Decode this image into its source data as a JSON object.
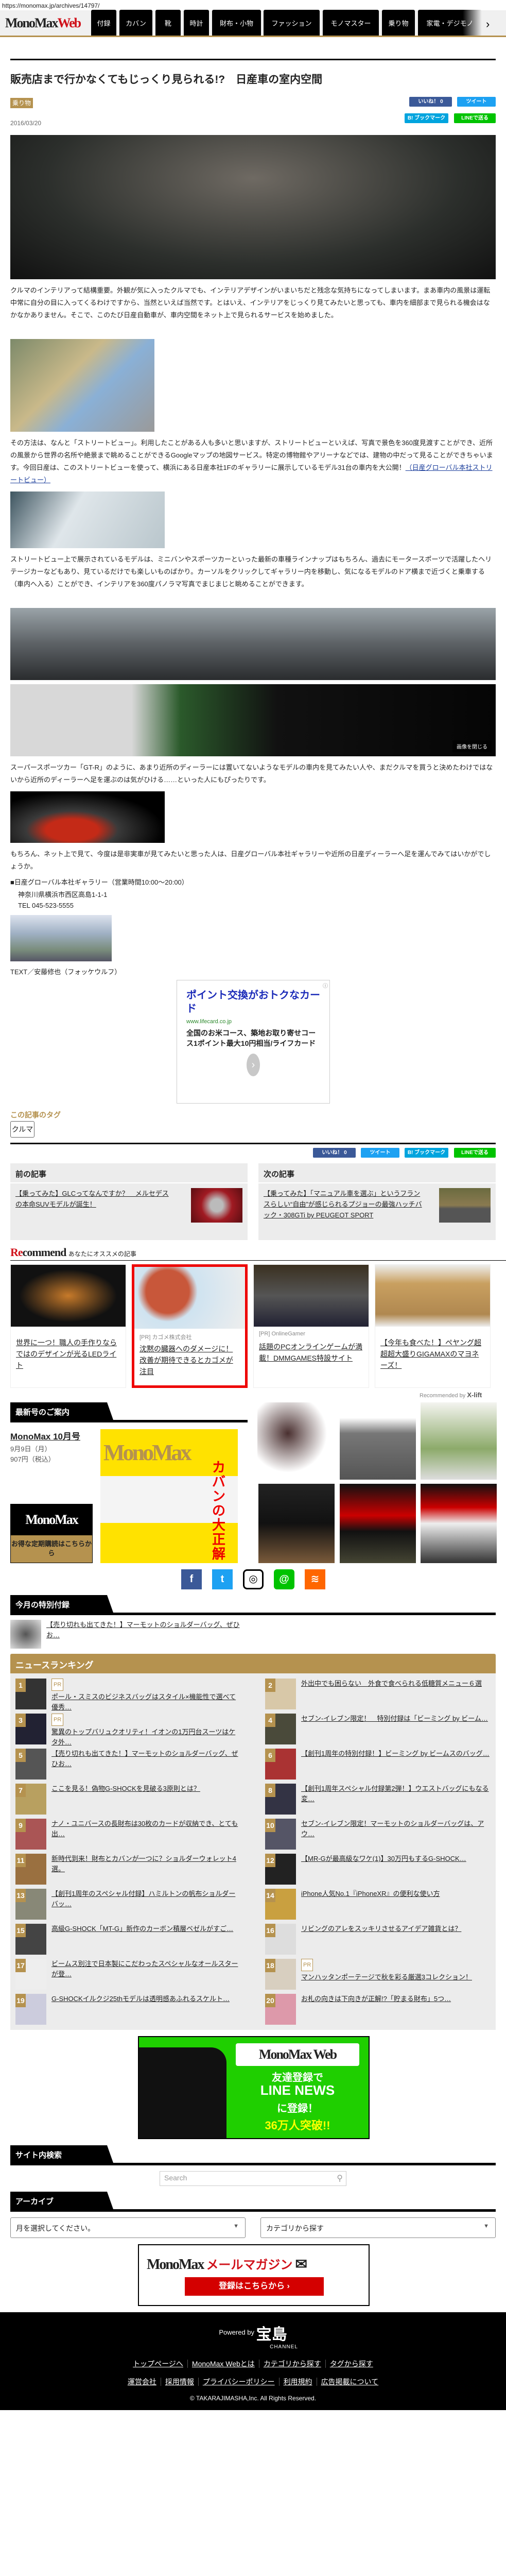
{
  "url": "https://monomax.jp/archives/14797/",
  "header": {
    "logo_mono": "MonoMax",
    "logo_web": "Web",
    "nav": [
      "付録",
      "カバン",
      "靴",
      "時計",
      "財布・小物",
      "ファッション",
      "モノマスター",
      "乗り物",
      "家電・デジモノ"
    ],
    "next": "›"
  },
  "article": {
    "title": "販売店まで行かなくてもじっくり見られる!?　日産車の室内空間",
    "category": "乗り物",
    "date": "2016/03/20",
    "share": {
      "like": "いいね！ 0",
      "tweet": "ツイート",
      "bookmark": "B! ブックマーク",
      "line": "LINEで送る"
    },
    "p1": "クルマのインテリアって結構重要。外観が気に入ったクルマでも、インテリアデザインがいまいちだと残念な気持ちになってしまいます。まあ車内の風景は運転中常に自分の目に入ってくるわけですから、当然といえば当然です。とはいえ、インテリアをじっくり見てみたいと思っても、車内を細部まで見られる機会はなかなかありません。そこで、このたび日産自動車が、車内空間をネット上で見られるサービスを始めました。",
    "p2": "その方法は、なんと「ストリートビュー」。利用したことがある人も多いと思いますが、ストリートビューといえば、写真で景色を360度見渡すことができ、近所の風景から世界の名所や絶景まで眺めることができるGoogleマップの地図サービス。特定の博物館やアリーナなどでは、建物の中だって見ることができちゃいます。今回日産は、このストリートビューを使って、横浜にある日産本社1Fのギャラリーに展示しているモデル31台の車内を大公開！",
    "p2_link": "（日産グローバル本社ストリートビュー）",
    "p3": "ストリートビュー上で展示されているモデルは、ミニバンやスポーツカーといった最新の車種ラインナップはもちろん、過去にモータースポーツで活躍したヘリテージカーなどもあり、見ているだけでも楽しいものばかり。カーソルをクリックしてギャラリー内を移動し、気になるモデルのドア横まで近づくと乗車する（車内へ入る）ことができ、インテリアを360度パノラマ写真でまじまじと眺めることができます。",
    "sv_control": "画像を閉じる",
    "p4": "スーパースポーツカー「GT-R」のように、あまり近所のディーラーには置いてないようなモデルの車内を見てみたい人や、まだクルマを買うと決めたわけではないから近所のディーラーへ足を運ぶのは気がひける……といった人にもぴったりです。",
    "p5": "もちろん、ネット上で見て、今度は是非実車が見てみたいと思った人は、日産グローバル本社ギャラリーや近所の日産ディーラーへ足を運んでみてはいかがでしょうか。",
    "gallery": "■日産グローバル本社ギャラリー（営業時間10:00～20:00）",
    "address": "神奈川県横浜市西区高島1-1-1",
    "tel": "TEL 045-523-5555",
    "credit": "TEXT／安藤修也（フォッケウルフ）"
  },
  "ad": {
    "info": "ⓘ",
    "headline": "ポイント交換がおトクなカード",
    "domain": "www.lifecard.co.jp",
    "desc": "全国のお米コース、築地お取り寄せコース1ポイント最大10円相当/ライフカード",
    "arrow": "›"
  },
  "tags": {
    "heading": "この記事のタグ",
    "items": [
      "クルマ"
    ]
  },
  "prevnext": {
    "prev_label": "前の記事",
    "prev_title": "【乗ってみた】GLCってなんですか？　メルセデスの本命SUVモデルが誕生！",
    "next_label": "次の記事",
    "next_title": "【乗ってみた】「マニュアル車を選ぶ」というフランスらしい“自由”が感じられるプジョーの最強ハッチバック・308GTi by PEUGEOT SPORT"
  },
  "recommend": {
    "heading_r": "Re",
    "heading_rest": "commend",
    "sub": "あなたにオススメの記事",
    "cards": [
      {
        "sponsor": "",
        "title": "世界に一つ！職人の手作りならではのデザインが光るLEDライト"
      },
      {
        "sponsor": "[PR] カゴメ株式会社",
        "title": "沈黙の臓器へのダメージに！改善が期待できるとカゴメが注目"
      },
      {
        "sponsor": "[PR] OnlineGamer",
        "title": "話題のPCオンラインゲームが満載！DMMGAMES特設サイト"
      },
      {
        "sponsor": "",
        "title": "【今年も食べた！】ペヤング超超超大盛りGIGAMAXのマヨネーズ！"
      }
    ],
    "by": "Recommended by",
    "by_brand": "X-lift"
  },
  "latest": {
    "heading": "最新号のご案内",
    "issue": "MonoMax 10月号",
    "date": "9月9日（月）",
    "price": "907円（税込）",
    "cover_logo": "MonoMax",
    "cover_headline": "カバンの大正解",
    "sub_logo": "MonoMax",
    "sub_text": "お得な定期購読はこちらから"
  },
  "social": [
    "f",
    "t",
    "◎",
    "@",
    "≋"
  ],
  "special": {
    "heading": "今月の特別付録",
    "item": "【売り切れも出てきた！】マーモットのショルダーバッグ、ぜひお…"
  },
  "ranking": {
    "heading": "ニュースランキング",
    "pr": "PR",
    "items": [
      {
        "n": "1",
        "pr": true,
        "t": "ポール・スミスのビジネスバッグはスタイル×機能性で選べて優秀…"
      },
      {
        "n": "2",
        "pr": false,
        "t": "外出中でも困らない　外食で食べられる低糖質メニュー６選"
      },
      {
        "n": "3",
        "pr": true,
        "t": "驚異のトップバリュクオリティ！イオンの1万円台スーツはケタ外…"
      },
      {
        "n": "4",
        "pr": false,
        "t": "セブン-イレブン限定！　特別付録は「ビーミング by ビーム…"
      },
      {
        "n": "5",
        "pr": false,
        "t": "【売り切れも出てきた！】マーモットのショルダーバッグ、ぜひお…"
      },
      {
        "n": "6",
        "pr": false,
        "t": "【創刊1周年の特別付録！】ビーミング by ビームスのバッグ…"
      },
      {
        "n": "7",
        "pr": false,
        "t": "ここを見る！偽物G-SHOCKを見破る3原則とは？"
      },
      {
        "n": "8",
        "pr": false,
        "t": "【創刊1周年スペシャル付録第2弾！】ウエストバッグにもなる変…"
      },
      {
        "n": "9",
        "pr": false,
        "t": "ナノ・ユニバースの長財布は30枚のカードが収納でき、とても出…"
      },
      {
        "n": "10",
        "pr": false,
        "t": "セブン-イレブン限定！マーモットのショルダーバッグは、アウ…"
      },
      {
        "n": "11",
        "pr": false,
        "t": "新時代到来！財布とカバンが一つに？ショルダーウォレット4選。"
      },
      {
        "n": "12",
        "pr": false,
        "t": "【MR-Gが最高級なワケ(1)】30万円もするG-SHOCK…"
      },
      {
        "n": "13",
        "pr": false,
        "t": "【創刊1周年のスペシャル付録】ハミルトンの帆布ショルダーバッ…"
      },
      {
        "n": "14",
        "pr": false,
        "t": "iPhone人気No.1『iPhoneXR』の便利な使い方"
      },
      {
        "n": "15",
        "pr": false,
        "t": "高級G-SHOCK「MT-G」新作のカーボン積層ベゼルがすご…"
      },
      {
        "n": "16",
        "pr": false,
        "t": "リビングのアレをスッキリさせるアイデア雑貨とは？"
      },
      {
        "n": "17",
        "pr": false,
        "t": "ビームス別注で日本製にこだわったスペシャルなオールスターが登…"
      },
      {
        "n": "18",
        "pr": true,
        "t": "マンハッタンポーテージで秋を彩る厳選3コレクション！"
      },
      {
        "n": "19",
        "pr": false,
        "t": "G-SHOCKイルクジ25thモデルは透明感あふれるスケルト…"
      },
      {
        "n": "20",
        "pr": false,
        "t": "お札の向きは下向きが正解!?「貯まる財布」5つ…"
      }
    ]
  },
  "line_banner": {
    "logo": "MonoMax Web",
    "l1": "友達登録で",
    "l2": "LINE NEWS",
    "l3": "に登録！",
    "l4": "36万人突破!!"
  },
  "search": {
    "heading": "サイト内検索",
    "placeholder": "Search"
  },
  "archive": {
    "heading": "アーカイブ",
    "month": "月を選択してください。",
    "category": "カテゴリから探す"
  },
  "mail": {
    "logo": "MonoMax",
    "title": "メールマガジン",
    "button": "登録はこちらから ›"
  },
  "footer": {
    "powered": "Powered by",
    "brand": "宝島",
    "channel": "CHANNEL",
    "row1": [
      "トップページへ",
      "MonoMax Webとは",
      "カテゴリから探す",
      "タグから探す"
    ],
    "row2": [
      "運営会社",
      "採用情報",
      "プライバシーポリシー",
      "利用規約",
      "広告掲載について"
    ],
    "copyright": "© TAKARAJIMASHA,Inc. All Rights Reserved."
  },
  "colors": {
    "gold": "#b5924f",
    "red": "#d0121b",
    "rank_bg": "#ececec"
  }
}
